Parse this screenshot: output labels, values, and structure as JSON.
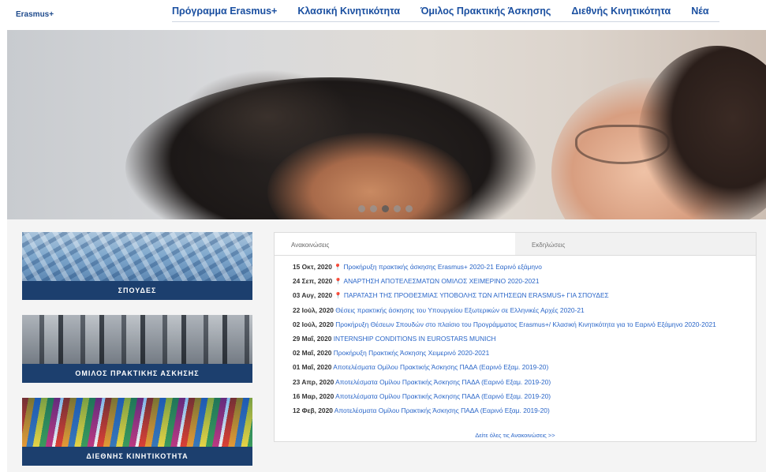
{
  "brand": "Erasmus+",
  "nav": [
    "Πρόγραμμα Erasmus+",
    "Κλασική Κινητικότητα",
    "Όμιλος Πρακτικής Άσκησης",
    "Διεθνής Κινητικότητα",
    "Νέα"
  ],
  "slider": {
    "dots": 5,
    "active_index": 2
  },
  "cards": [
    {
      "label": "ΣΠΟΥΔΕΣ"
    },
    {
      "label": "ΟΜΙΛΟΣ ΠΡΑΚΤΙΚΗΣ ΑΣΚΗΣΗΣ"
    },
    {
      "label": "ΔΙΕΘΝΗΣ ΚΙΝΗΤΙΚΟΤΗΤΑ"
    }
  ],
  "news": {
    "tabs": [
      "Ανακοινώσεις",
      "Εκδηλώσεις"
    ],
    "items": [
      {
        "date": "15 Οκτ, 2020",
        "pinned": true,
        "title": "Προκήρυξη πρακτικής άσκησης Erasmus+ 2020-21 Εαρινό εξάμηνο"
      },
      {
        "date": "24 Σεπ, 2020",
        "pinned": true,
        "title": "ΑΝΑΡΤΗΣΗ ΑΠΟΤΕΛΕΣΜΑΤΩΝ ΟΜΙΛΟΣ ΧΕΙΜΕΡΙΝΟ 2020-2021"
      },
      {
        "date": "03 Αυγ, 2020",
        "pinned": true,
        "title": "ΠΑΡΑΤΑΣΗ ΤΗΣ ΠΡΟΘΕΣΜΙΑΣ ΥΠΟΒΟΛΗΣ ΤΩΝ ΑΙΤΗΣΕΩΝ ERASMUS+ ΓΙΑ ΣΠΟΥΔΕΣ"
      },
      {
        "date": "22 Ιούλ, 2020",
        "pinned": false,
        "title": "Θέσεις πρακτικής άσκησης του Υπουργείου Εξωτερικών σε Ελληνικές Αρχές 2020-21"
      },
      {
        "date": "02 Ιούλ, 2020",
        "pinned": false,
        "title": "Προκήρυξη Θέσεων Σπουδών στο πλαίσιο του Προγράμματος Erasmus+/ Κλασική Κινητικότητα για το Εαρινό Εξάμηνο 2020-2021"
      },
      {
        "date": "29 Μαΐ, 2020",
        "pinned": false,
        "title": "INTERNSHIP CONDITIONS IN EUROSTARS MUNICH"
      },
      {
        "date": "02 Μαΐ, 2020",
        "pinned": false,
        "title": "Προκήρυξη Πρακτικής Άσκησης Χειμερινό 2020-2021"
      },
      {
        "date": "01 Μαΐ, 2020",
        "pinned": false,
        "title": "Αποτελέσματα Ομίλου Πρακτικής Άσκησης ΠΑΔΑ (Εαρινό Εξαμ. 2019-20)"
      },
      {
        "date": "23 Απρ, 2020",
        "pinned": false,
        "title": "Αποτελέσματα Ομίλου Πρακτικής Άσκησης ΠΑΔΑ (Εαρινό Εξαμ. 2019-20)"
      },
      {
        "date": "16 Μαρ, 2020",
        "pinned": false,
        "title": "Αποτελέσματα Ομίλου Πρακτικής Άσκησης ΠΑΔΑ (Εαρινό Εξαμ. 2019-20)"
      },
      {
        "date": "12 Φεβ, 2020",
        "pinned": false,
        "title": "Αποτελέσματα Ομίλου Πρακτικής Άσκησης ΠΑΔΑ (Εαρινό Εξαμ. 2019-20)"
      }
    ],
    "see_all": "Δείτε όλες τις Ανακοινώσεις >>"
  },
  "colors": {
    "nav_text": "#1a4fa0",
    "card_label_bg": "#1c3f6e",
    "link": "#2a66c8",
    "pin": "#b0362a"
  }
}
